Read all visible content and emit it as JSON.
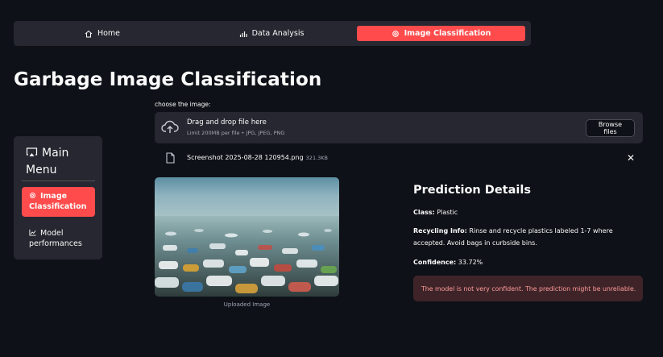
{
  "topnav": {
    "items": [
      {
        "label": "Home",
        "icon": "home-icon"
      },
      {
        "label": "Data Analysis",
        "icon": "bar-chart-icon"
      },
      {
        "label": "Image Classification",
        "icon": "gear-icon",
        "active": true
      }
    ]
  },
  "page": {
    "title": "Garbage Image Classification"
  },
  "sidebar": {
    "title": "Main Menu",
    "items": [
      {
        "label": "Image Classification",
        "icon": "gear-icon",
        "active": true
      },
      {
        "label": "Model performances",
        "icon": "line-chart-icon"
      }
    ]
  },
  "uploader": {
    "label": "choose the image:",
    "drop_text": "Drag and drop file here",
    "limit_text": "Limit 200MB per file • JPG, JPEG, PNG",
    "browse_label": "Browse files",
    "file": {
      "name": "Screenshot 2025-08-28 120954.png",
      "size": "321.3KB"
    }
  },
  "image": {
    "caption": "Uploaded Image"
  },
  "prediction": {
    "title": "Prediction Details",
    "class_label": "Class:",
    "class_value": "Plastic",
    "recycling_label": "Recycling Info:",
    "recycling_value": "Rinse and recycle plastics labeled 1-7 where accepted. Avoid bags in curbside bins.",
    "confidence_label": "Confidence:",
    "confidence_value": "33.72%",
    "warning": "The model is not very confident. The prediction might be unreliable."
  },
  "colors": {
    "accent": "#ff4b4b",
    "background": "#0e1117",
    "panel": "#262730",
    "warning_bg": "#3e2428"
  }
}
